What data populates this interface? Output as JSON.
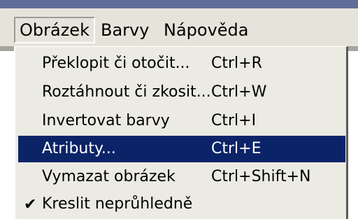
{
  "menubar": {
    "items": [
      {
        "label": "Obrázek"
      },
      {
        "label": "Barvy"
      },
      {
        "label": "Nápověda"
      }
    ]
  },
  "dropdown": {
    "items": [
      {
        "label": "Překlopit či otočit...",
        "shortcut": "Ctrl+R",
        "checked": false,
        "selected": false
      },
      {
        "label": "Roztáhnout či zkosit...",
        "shortcut": "Ctrl+W",
        "checked": false,
        "selected": false
      },
      {
        "label": "Invertovat barvy",
        "shortcut": "Ctrl+I",
        "checked": false,
        "selected": false
      },
      {
        "label": "Atributy...",
        "shortcut": "Ctrl+E",
        "checked": false,
        "selected": true
      },
      {
        "label": "Vymazat obrázek",
        "shortcut": "Ctrl+Shift+N",
        "checked": false,
        "selected": false
      },
      {
        "label": "Kreslit neprůhledně",
        "shortcut": "",
        "checked": true,
        "selected": false
      }
    ],
    "check_glyph": "✔"
  },
  "colors": {
    "selection": "#0b2468",
    "menu_background": "#ecebe3",
    "title_strip": "#5f6d99"
  }
}
